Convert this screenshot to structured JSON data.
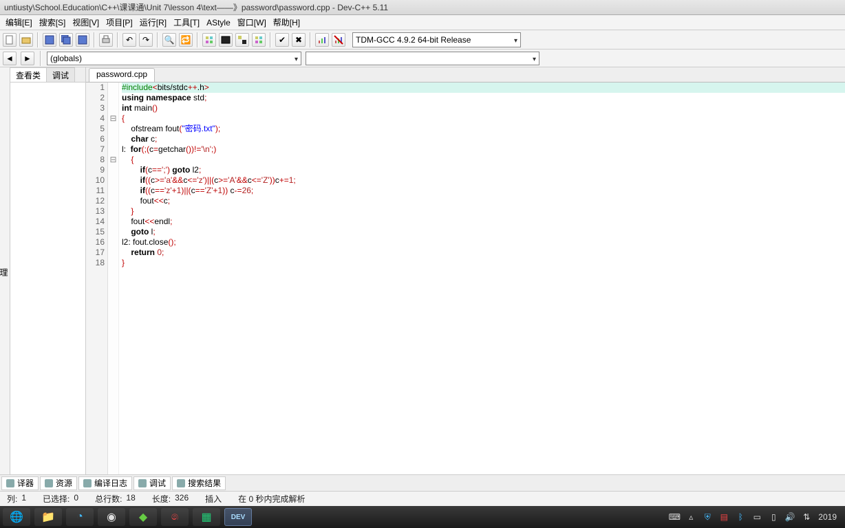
{
  "title": "untiusty\\School.Education\\C++\\课课通\\Unit 7\\lesson 4\\text——》password\\password.cpp - Dev-C++ 5.11",
  "menu": [
    "编辑[E]",
    "搜索[S]",
    "视图[V]",
    "项目[P]",
    "运行[R]",
    "工具[T]",
    "AStyle",
    "窗口[W]",
    "帮助[H]"
  ],
  "compiler_combo": "TDM-GCC 4.9.2 64-bit Release",
  "globals_combo": "(globals)",
  "side_tabs": [
    "查看类",
    "调试"
  ],
  "left_label": "理",
  "file_tab": "password.cpp",
  "code_lines": [
    {
      "n": "1",
      "fold": "",
      "html": "<span class='pp'>#include</span><span class='op'>&lt;</span>bits/stdc<span class='op'>++</span>.h<span class='op'>&gt;</span>",
      "hl": true
    },
    {
      "n": "2",
      "fold": "",
      "html": "<span class='kw'>using</span> <span class='kw'>namespace</span> std<span class='op'>;</span>"
    },
    {
      "n": "3",
      "fold": "",
      "html": "<span class='kw'>int</span> main<span class='op'>()</span>"
    },
    {
      "n": "4",
      "fold": "⊟",
      "html": "<span class='op'>{</span>"
    },
    {
      "n": "5",
      "fold": "",
      "html": "    ofstream fout<span class='op'>(</span><span class='str'>\"密码.txt\"</span><span class='op'>);</span>"
    },
    {
      "n": "6",
      "fold": "",
      "html": "    <span class='kw'>char</span> c<span class='op'>;</span>"
    },
    {
      "n": "7",
      "fold": "",
      "html": "l:  <span class='kw'>for</span><span class='op'>(;(</span>c<span class='op'>=</span>getchar<span class='op'>())!=</span><span class='ch'>'\\n'</span><span class='op'>;)</span>"
    },
    {
      "n": "8",
      "fold": "⊟",
      "html": "    <span class='op'>{</span>"
    },
    {
      "n": "9",
      "fold": "",
      "html": "        <span class='kw'>if</span><span class='op'>(</span>c<span class='op'>==</span><span class='ch'>';'</span><span class='op'>)</span> <span class='kw'>goto</span> l2<span class='op'>;</span>"
    },
    {
      "n": "10",
      "fold": "",
      "html": "        <span class='kw'>if</span><span class='op'>((</span>c<span class='op'>&gt;=</span><span class='ch'>'a'</span><span class='op'>&amp;&amp;</span>c<span class='op'>&lt;=</span><span class='ch'>'z'</span><span class='op'>)||(</span>c<span class='op'>&gt;=</span><span class='ch'>'A'</span><span class='op'>&amp;&amp;</span>c<span class='op'>&lt;=</span><span class='ch'>'Z'</span><span class='op'>))</span>c<span class='op'>+=</span><span class='num'>1</span><span class='op'>;</span>"
    },
    {
      "n": "11",
      "fold": "",
      "html": "        <span class='kw'>if</span><span class='op'>((</span>c<span class='op'>==</span><span class='ch'>'z'</span><span class='op'>+</span><span class='num'>1</span><span class='op'>)||(</span>c<span class='op'>==</span><span class='ch'>'Z'</span><span class='op'>+</span><span class='num'>1</span><span class='op'>))</span> c<span class='op'>-=</span><span class='num'>26</span><span class='op'>;</span>"
    },
    {
      "n": "12",
      "fold": "",
      "html": "        fout<span class='op'>&lt;&lt;</span>c<span class='op'>;</span>"
    },
    {
      "n": "13",
      "fold": "",
      "html": "    <span class='op'>}</span>"
    },
    {
      "n": "14",
      "fold": "",
      "html": "    fout<span class='op'>&lt;&lt;</span>endl<span class='op'>;</span>"
    },
    {
      "n": "15",
      "fold": "",
      "html": "    <span class='kw'>goto</span> l<span class='op'>;</span>"
    },
    {
      "n": "16",
      "fold": "",
      "html": "l2: fout.close<span class='op'>();</span>"
    },
    {
      "n": "17",
      "fold": "",
      "html": "    <span class='kw'>return</span> <span class='num'>0</span><span class='op'>;</span>"
    },
    {
      "n": "18",
      "fold": "",
      "html": "<span class='op'>}</span>"
    }
  ],
  "bottom_tabs": [
    "译器",
    "资源",
    "编译日志",
    "调试",
    "搜索结果"
  ],
  "status": {
    "col_label": "列:",
    "col": "1",
    "sel_label": "已选择:",
    "sel": "0",
    "lines_label": "总行数:",
    "lines": "18",
    "len_label": "长度:",
    "len": "326",
    "mode": "插入",
    "done": "在 0 秒内完成解析"
  },
  "tray_time": "2019"
}
